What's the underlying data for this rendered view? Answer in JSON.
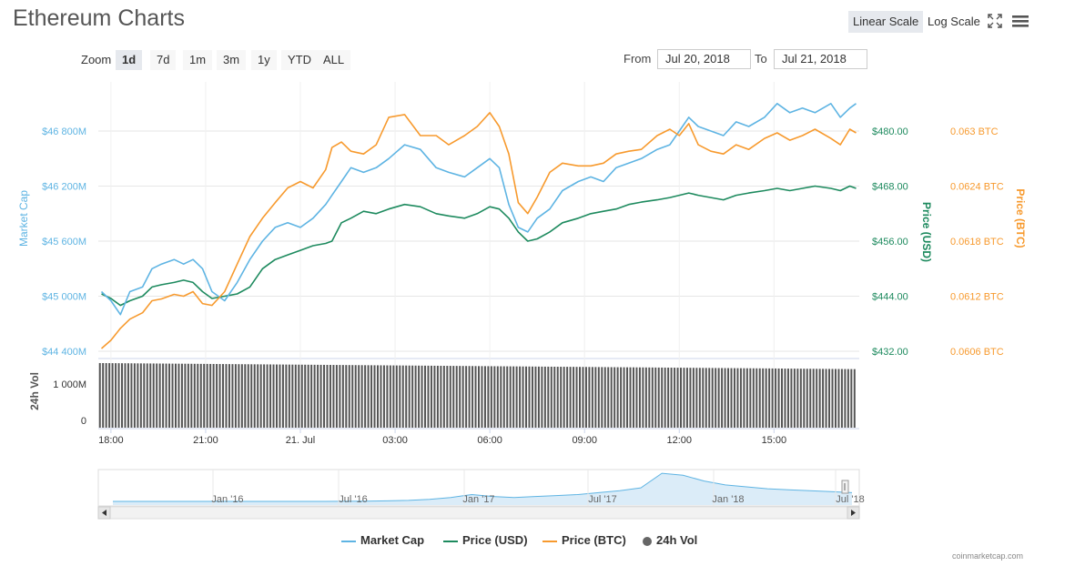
{
  "page": {
    "title": "Ethereum Charts",
    "linear_scale_label": "Linear Scale",
    "log_scale_label": "Log Scale",
    "fullscreen_icon": "fullscreen-icon",
    "menu_icon": "hamburger-menu-icon",
    "zoom_label": "Zoom",
    "zoom_buttons": [
      "1d",
      "7d",
      "1m",
      "3m",
      "1y",
      "YTD",
      "ALL"
    ],
    "zoom_active": "1d",
    "from_label": "From",
    "to_label": "To",
    "from_value": "Jul 20, 2018",
    "to_value": "Jul 21, 2018",
    "credits": "coinmarketcap.com"
  },
  "colors": {
    "market_cap": "#5eb4e3",
    "price_usd": "#1d8a5e",
    "price_btc": "#f79a2e",
    "volume": "#555555"
  },
  "chart_data": {
    "type": "line",
    "x_tick_labels": [
      "18:00",
      "21:00",
      "21. Jul",
      "03:00",
      "06:00",
      "09:00",
      "12:00",
      "15:00"
    ],
    "x_tick_hours": [
      0,
      3,
      6,
      9,
      12,
      15,
      18,
      21
    ],
    "x_range_hours": [
      -0.4,
      23.7
    ],
    "axes": {
      "market_cap": {
        "title": "Market Cap",
        "ticks": [
          "$44 400M",
          "$45 000M",
          "$45 600M",
          "$46 200M",
          "$46 800M"
        ],
        "range": [
          44400,
          46800
        ]
      },
      "price_usd": {
        "title": "Price (USD)",
        "ticks": [
          "$432.00",
          "$444.00",
          "$456.00",
          "$468.00",
          "$480.00"
        ],
        "range": [
          432,
          480
        ]
      },
      "price_btc": {
        "title": "Price (BTC)",
        "ticks": [
          "0.0606 BTC",
          "0.0612 BTC",
          "0.0618 BTC",
          "0.0624 BTC",
          "0.063 BTC"
        ],
        "range": [
          0.0606,
          0.063
        ]
      },
      "volume": {
        "title": "24h Vol",
        "ticks": [
          "0",
          "1 000M"
        ],
        "range": [
          0,
          1000
        ]
      }
    },
    "series": [
      {
        "name": "Market Cap",
        "unit": "USD millions",
        "points": [
          [
            -0.3,
            45050
          ],
          [
            0,
            44950
          ],
          [
            0.3,
            44800
          ],
          [
            0.6,
            45050
          ],
          [
            1,
            45100
          ],
          [
            1.3,
            45300
          ],
          [
            1.6,
            45350
          ],
          [
            2,
            45400
          ],
          [
            2.3,
            45350
          ],
          [
            2.6,
            45400
          ],
          [
            2.9,
            45300
          ],
          [
            3.2,
            45050
          ],
          [
            3.6,
            44950
          ],
          [
            4,
            45150
          ],
          [
            4.4,
            45400
          ],
          [
            4.8,
            45600
          ],
          [
            5.2,
            45750
          ],
          [
            5.6,
            45800
          ],
          [
            6,
            45750
          ],
          [
            6.4,
            45850
          ],
          [
            6.8,
            46000
          ],
          [
            7,
            46100
          ],
          [
            7.3,
            46250
          ],
          [
            7.6,
            46400
          ],
          [
            8,
            46350
          ],
          [
            8.4,
            46400
          ],
          [
            8.8,
            46500
          ],
          [
            9.3,
            46650
          ],
          [
            9.8,
            46600
          ],
          [
            10.3,
            46400
          ],
          [
            10.7,
            46350
          ],
          [
            11.2,
            46300
          ],
          [
            11.6,
            46400
          ],
          [
            12,
            46500
          ],
          [
            12.3,
            46400
          ],
          [
            12.6,
            46000
          ],
          [
            12.9,
            45750
          ],
          [
            13.2,
            45700
          ],
          [
            13.5,
            45850
          ],
          [
            13.9,
            45950
          ],
          [
            14.3,
            46150
          ],
          [
            14.8,
            46250
          ],
          [
            15.2,
            46300
          ],
          [
            15.6,
            46250
          ],
          [
            16,
            46400
          ],
          [
            16.4,
            46450
          ],
          [
            16.8,
            46500
          ],
          [
            17.3,
            46600
          ],
          [
            17.7,
            46650
          ],
          [
            18,
            46800
          ],
          [
            18.3,
            46950
          ],
          [
            18.6,
            46850
          ],
          [
            19,
            46800
          ],
          [
            19.4,
            46750
          ],
          [
            19.8,
            46900
          ],
          [
            20.2,
            46850
          ],
          [
            20.7,
            46950
          ],
          [
            21.1,
            47100
          ],
          [
            21.5,
            47000
          ],
          [
            21.9,
            47050
          ],
          [
            22.3,
            47000
          ],
          [
            22.8,
            47100
          ],
          [
            23.1,
            46950
          ],
          [
            23.4,
            47050
          ],
          [
            23.6,
            47100
          ]
        ]
      },
      {
        "name": "Price (USD)",
        "unit": "USD",
        "points": [
          [
            -0.3,
            444.5
          ],
          [
            0,
            443.5
          ],
          [
            0.3,
            442
          ],
          [
            0.6,
            443
          ],
          [
            1,
            444
          ],
          [
            1.3,
            446
          ],
          [
            1.6,
            446.5
          ],
          [
            2,
            447
          ],
          [
            2.3,
            447.5
          ],
          [
            2.6,
            447
          ],
          [
            2.9,
            445
          ],
          [
            3.2,
            443.5
          ],
          [
            3.6,
            444
          ],
          [
            4,
            444.5
          ],
          [
            4.4,
            446
          ],
          [
            4.8,
            450
          ],
          [
            5.2,
            452
          ],
          [
            5.6,
            453
          ],
          [
            6,
            454
          ],
          [
            6.4,
            455
          ],
          [
            6.8,
            455.5
          ],
          [
            7,
            456
          ],
          [
            7.3,
            460
          ],
          [
            7.6,
            461
          ],
          [
            8,
            462.5
          ],
          [
            8.4,
            462
          ],
          [
            8.8,
            463
          ],
          [
            9.3,
            464
          ],
          [
            9.8,
            463.5
          ],
          [
            10.3,
            462
          ],
          [
            10.7,
            461.5
          ],
          [
            11.2,
            461
          ],
          [
            11.6,
            462
          ],
          [
            12,
            463.5
          ],
          [
            12.3,
            463
          ],
          [
            12.6,
            461
          ],
          [
            12.9,
            458
          ],
          [
            13.2,
            456
          ],
          [
            13.5,
            456.5
          ],
          [
            13.9,
            458
          ],
          [
            14.3,
            460
          ],
          [
            14.8,
            461
          ],
          [
            15.2,
            462
          ],
          [
            15.6,
            462.5
          ],
          [
            16,
            463
          ],
          [
            16.4,
            464
          ],
          [
            16.8,
            464.5
          ],
          [
            17.3,
            465
          ],
          [
            17.7,
            465.5
          ],
          [
            18,
            466
          ],
          [
            18.3,
            466.5
          ],
          [
            18.6,
            466
          ],
          [
            19,
            465.5
          ],
          [
            19.4,
            465
          ],
          [
            19.8,
            466
          ],
          [
            20.2,
            466.5
          ],
          [
            20.7,
            467
          ],
          [
            21.1,
            467.5
          ],
          [
            21.5,
            467
          ],
          [
            21.9,
            467.5
          ],
          [
            22.3,
            468
          ],
          [
            22.8,
            467.5
          ],
          [
            23.1,
            467
          ],
          [
            23.4,
            468
          ],
          [
            23.6,
            467.5
          ]
        ]
      },
      {
        "name": "Price (BTC)",
        "unit": "BTC",
        "points": [
          [
            -0.3,
            0.06063
          ],
          [
            0,
            0.06072
          ],
          [
            0.3,
            0.06085
          ],
          [
            0.6,
            0.06095
          ],
          [
            1,
            0.06102
          ],
          [
            1.3,
            0.06115
          ],
          [
            1.6,
            0.06117
          ],
          [
            2,
            0.06122
          ],
          [
            2.3,
            0.0612
          ],
          [
            2.6,
            0.06125
          ],
          [
            2.9,
            0.06112
          ],
          [
            3.2,
            0.0611
          ],
          [
            3.6,
            0.06125
          ],
          [
            4,
            0.06155
          ],
          [
            4.4,
            0.06185
          ],
          [
            4.8,
            0.06205
          ],
          [
            5.2,
            0.06222
          ],
          [
            5.6,
            0.06238
          ],
          [
            6,
            0.06245
          ],
          [
            6.4,
            0.06238
          ],
          [
            6.8,
            0.06258
          ],
          [
            7,
            0.06282
          ],
          [
            7.3,
            0.06288
          ],
          [
            7.6,
            0.06278
          ],
          [
            8,
            0.06275
          ],
          [
            8.4,
            0.06285
          ],
          [
            8.8,
            0.06315
          ],
          [
            9.3,
            0.06318
          ],
          [
            9.8,
            0.06295
          ],
          [
            10.3,
            0.06295
          ],
          [
            10.7,
            0.06285
          ],
          [
            11.2,
            0.06295
          ],
          [
            11.6,
            0.06305
          ],
          [
            12,
            0.0632
          ],
          [
            12.3,
            0.06305
          ],
          [
            12.6,
            0.06275
          ],
          [
            12.9,
            0.06222
          ],
          [
            13.2,
            0.0621
          ],
          [
            13.5,
            0.06228
          ],
          [
            13.9,
            0.06255
          ],
          [
            14.3,
            0.06265
          ],
          [
            14.8,
            0.06262
          ],
          [
            15.2,
            0.06262
          ],
          [
            15.6,
            0.06265
          ],
          [
            16,
            0.06275
          ],
          [
            16.4,
            0.06278
          ],
          [
            16.8,
            0.0628
          ],
          [
            17.3,
            0.06295
          ],
          [
            17.7,
            0.06302
          ],
          [
            18,
            0.06295
          ],
          [
            18.3,
            0.06308
          ],
          [
            18.6,
            0.06285
          ],
          [
            19,
            0.06278
          ],
          [
            19.4,
            0.06275
          ],
          [
            19.8,
            0.06285
          ],
          [
            20.2,
            0.0628
          ],
          [
            20.7,
            0.06292
          ],
          [
            21.1,
            0.06298
          ],
          [
            21.5,
            0.0629
          ],
          [
            21.9,
            0.06295
          ],
          [
            22.3,
            0.06302
          ],
          [
            22.8,
            0.06292
          ],
          [
            23.1,
            0.06285
          ],
          [
            23.4,
            0.06302
          ],
          [
            23.6,
            0.06298
          ]
        ]
      }
    ],
    "volume": {
      "unit": "USD millions",
      "start": 1480,
      "end": 1340,
      "interval_hours": 0.1
    },
    "navigator": {
      "labels": [
        "Jan '16",
        "Jul '16",
        "Jan '17",
        "Jul '17",
        "Jan '18",
        "Jul '18"
      ],
      "values": [
        0.9,
        0.9,
        0.9,
        0.9,
        0.9,
        0.9,
        0.9,
        0.9,
        0.9,
        0.9,
        0.9,
        1,
        1.2,
        1.5,
        2,
        3,
        5,
        8,
        6,
        5,
        6,
        7,
        8,
        10,
        12,
        15,
        30,
        28,
        22,
        18,
        16,
        14,
        13,
        12,
        11,
        10
      ]
    },
    "legend": [
      "Market Cap",
      "Price (USD)",
      "Price (BTC)",
      "24h Vol"
    ]
  }
}
